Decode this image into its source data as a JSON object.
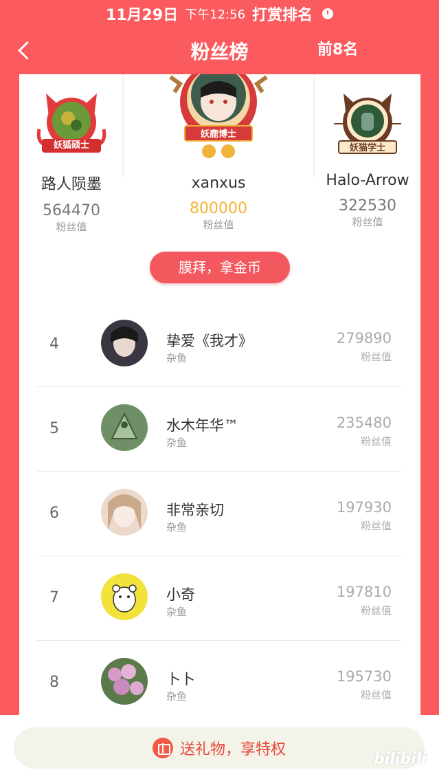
{
  "status_bar": {
    "date": "11月29日",
    "time": "下午12:56",
    "title": "打赏排名"
  },
  "nav": {
    "title": "粉丝榜",
    "right_label": "前8名"
  },
  "podium": [
    {
      "rank": 2,
      "name": "路人陨墨",
      "value": "564470",
      "unit": "粉丝值",
      "badge": "妖狐硕士"
    },
    {
      "rank": 1,
      "name": "xanxus",
      "value": "800000",
      "unit": "粉丝值",
      "badge": "妖鹿博士"
    },
    {
      "rank": 3,
      "name": "Halo-Arrow",
      "value": "322530",
      "unit": "粉丝值",
      "badge": "妖猫学士"
    }
  ],
  "worship_button": "膜拜，拿金币",
  "list": [
    {
      "rank": "4",
      "name": "挚爱《我才》",
      "level": "杂鱼",
      "score": "279890",
      "unit": "粉丝值"
    },
    {
      "rank": "5",
      "name": "水木年华™",
      "level": "杂鱼",
      "score": "235480",
      "unit": "粉丝值"
    },
    {
      "rank": "6",
      "name": "非常亲切",
      "level": "杂鱼",
      "score": "197930",
      "unit": "粉丝值"
    },
    {
      "rank": "7",
      "name": "小奇",
      "level": "杂鱼",
      "score": "197810",
      "unit": "粉丝值"
    },
    {
      "rank": "8",
      "name": "卜卜",
      "level": "杂鱼",
      "score": "195730",
      "unit": "粉丝值"
    }
  ],
  "gift_button": "送礼物，享特权",
  "watermark": "bilibili",
  "colors": {
    "background": "#fb5a5e",
    "gold_value": "#f5b533",
    "button": "#f2585e"
  }
}
